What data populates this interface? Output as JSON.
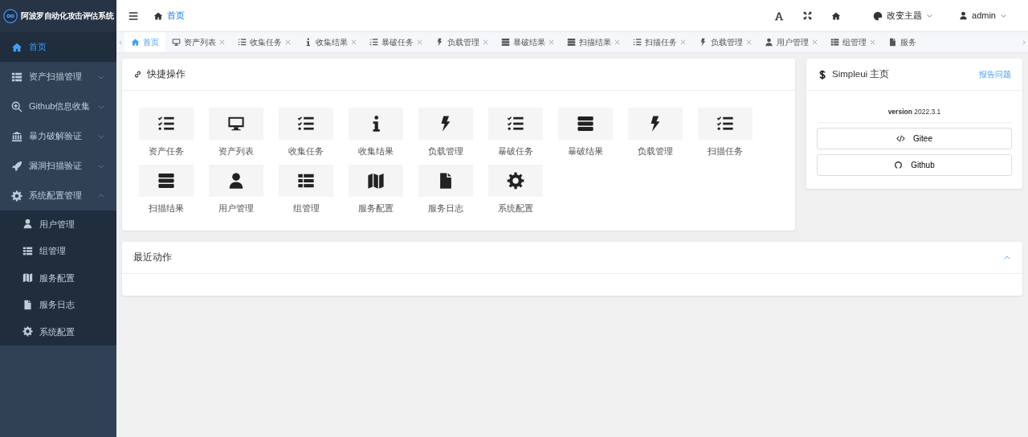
{
  "app": {
    "title": "阿波罗自动化攻击评估系统"
  },
  "sidebar": {
    "items": [
      {
        "label": "首页",
        "selected": true
      },
      {
        "label": "资产扫描管理",
        "selected": false,
        "expanded": false
      },
      {
        "label": "Github信息收集",
        "selected": false,
        "expanded": false
      },
      {
        "label": "暴力破解验证",
        "selected": false,
        "expanded": false
      },
      {
        "label": "漏洞扫描验证",
        "selected": false,
        "expanded": false
      },
      {
        "label": "系统配置管理",
        "selected": false,
        "expanded": true,
        "children": [
          {
            "label": "用户管理",
            "selected": false
          },
          {
            "label": "组管理",
            "selected": false
          },
          {
            "label": "服务配置",
            "selected": false
          },
          {
            "label": "服务日志",
            "selected": false
          },
          {
            "label": "系统配置",
            "selected": false
          }
        ]
      }
    ]
  },
  "header": {
    "breadcrumb": "首页",
    "theme": "改变主题",
    "user": "admin"
  },
  "tab_scroll": {
    "left": "‹",
    "right": "›"
  },
  "tabs": [
    {
      "label": "首页",
      "selected": true,
      "closable": false
    },
    {
      "label": "资产列表",
      "selected": false,
      "closable": true
    },
    {
      "label": "收集任务",
      "selected": false,
      "closable": true
    },
    {
      "label": "收集结果",
      "selected": false,
      "closable": true
    },
    {
      "label": "暴破任务",
      "selected": false,
      "closable": true
    },
    {
      "label": "负载管理",
      "selected": false,
      "closable": true
    },
    {
      "label": "暴破结果",
      "selected": false,
      "closable": true
    },
    {
      "label": "扫描结果",
      "selected": false,
      "closable": true
    },
    {
      "label": "扫描任务",
      "selected": false,
      "closable": true
    },
    {
      "label": "负载管理",
      "selected": false,
      "closable": true
    },
    {
      "label": "用户管理",
      "selected": false,
      "closable": true
    },
    {
      "label": "组管理",
      "selected": false,
      "closable": true
    },
    {
      "label": "服务",
      "selected": false,
      "closable": false
    }
  ],
  "quick": {
    "title": "快捷操作",
    "items": [
      {
        "label": "资产任务"
      },
      {
        "label": "资产列表"
      },
      {
        "label": "收集任务"
      },
      {
        "label": "收集结果"
      },
      {
        "label": "负载管理"
      },
      {
        "label": "暴破任务"
      },
      {
        "label": "暴破结果"
      },
      {
        "label": "负载管理"
      },
      {
        "label": "扫描任务"
      },
      {
        "label": "扫描结果"
      },
      {
        "label": "用户管理"
      },
      {
        "label": "组管理"
      },
      {
        "label": "服务配置"
      },
      {
        "label": "服务日志"
      },
      {
        "label": "系统配置"
      }
    ]
  },
  "about": {
    "title": "Simpleui 主页",
    "link": "报告问题",
    "version": "**version** 2022.3.1",
    "buttons": [
      "Gitee",
      "Github"
    ]
  },
  "recent": {
    "title": "最近动作",
    "expanded": true
  }
}
